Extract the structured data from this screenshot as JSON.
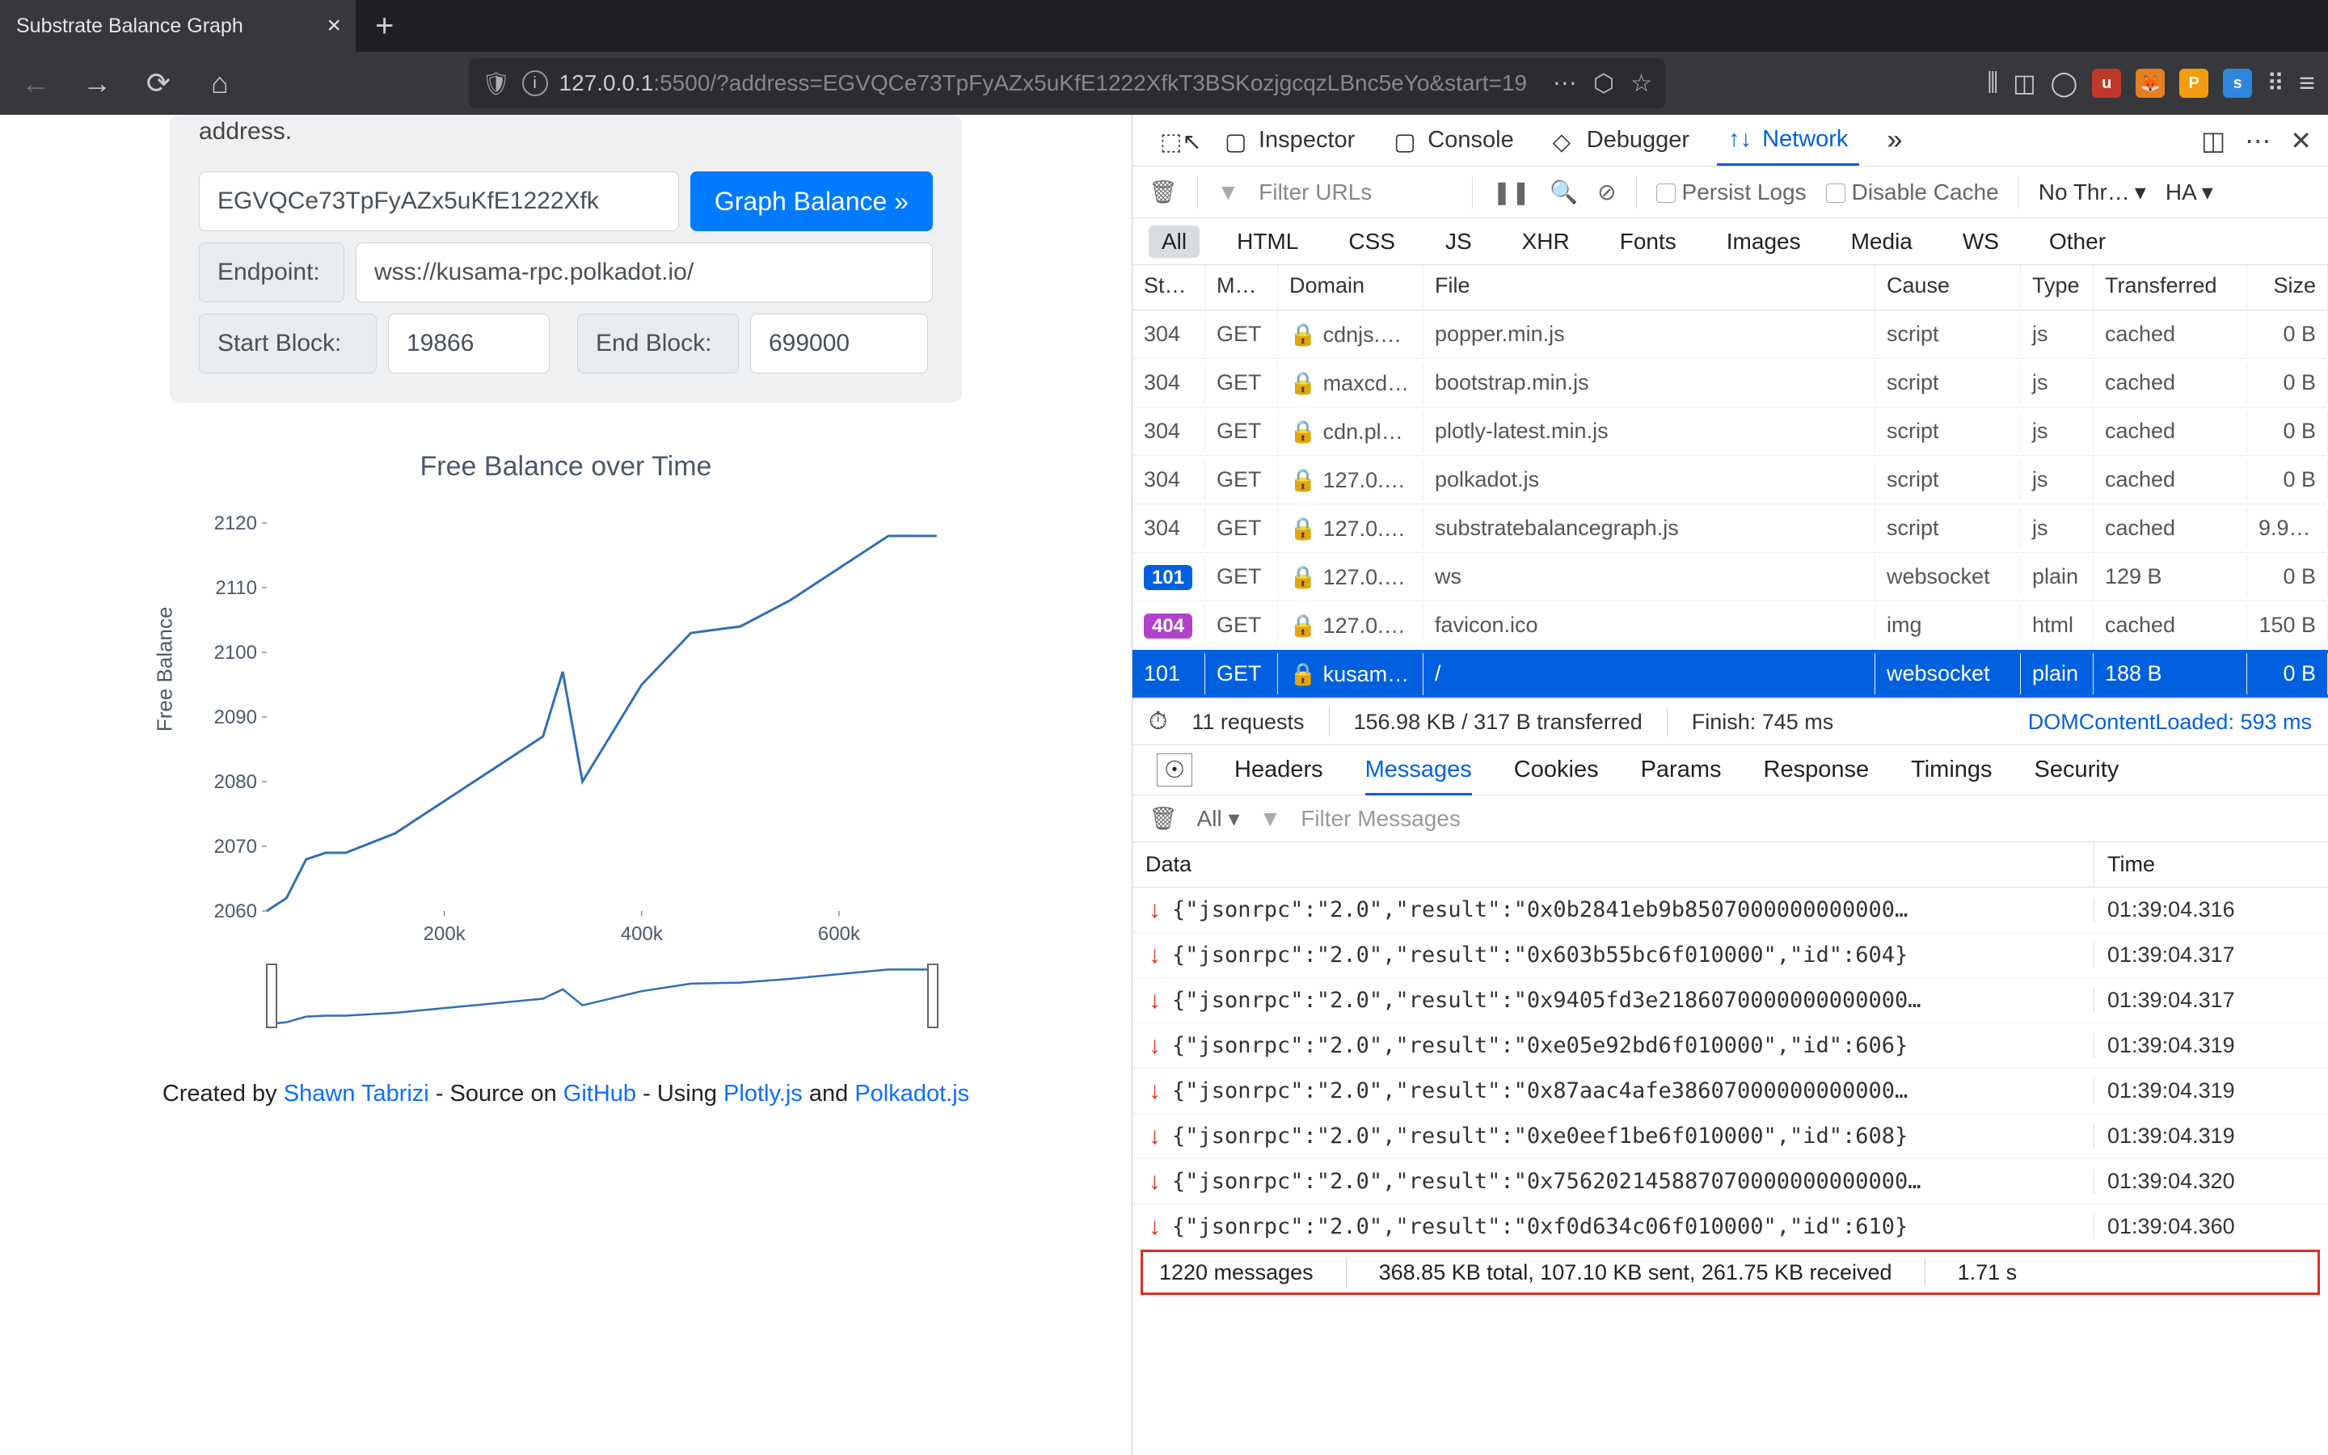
{
  "browser": {
    "tab_title": "Substrate Balance Graph",
    "url_host": "127.0.0.1",
    "url_port": ":5500",
    "url_rest": "/?address=EGVQCe73TpFyAZx5uKfE1222XfkT3BSKozjgcqzLBnc5eYo&start=19"
  },
  "form": {
    "desc_tail": "address.",
    "addr_value": "EGVQCe73TpFyAZx5uKfE1222Xfk",
    "graph_btn": "Graph Balance »",
    "endpoint_label": "Endpoint:",
    "endpoint_value": "wss://kusama-rpc.polkadot.io/",
    "start_label": "Start Block:",
    "start_value": "19866",
    "end_label": "End Block:",
    "end_value": "699000"
  },
  "chart_data": {
    "type": "line",
    "title": "Free Balance over Time",
    "xlabel": "",
    "ylabel": "Free Balance",
    "ylim": [
      2060,
      2120
    ],
    "xlim": [
      20000,
      700000
    ],
    "x_ticks": [
      "200k",
      "400k",
      "600k"
    ],
    "y_ticks": [
      2060,
      2070,
      2080,
      2090,
      2100,
      2110,
      2120
    ],
    "series": [
      {
        "name": "Free Balance",
        "x": [
          20000,
          40000,
          60000,
          80000,
          100000,
          150000,
          200000,
          250000,
          300000,
          320000,
          340000,
          360000,
          380000,
          400000,
          450000,
          500000,
          550000,
          600000,
          650000,
          699000
        ],
        "values": [
          2060,
          2062,
          2068,
          2069,
          2069,
          2072,
          2077,
          2082,
          2087,
          2097,
          2080,
          2085,
          2090,
          2095,
          2103,
          2104,
          2108,
          2113,
          2118,
          2118
        ]
      }
    ],
    "rangeslider": true
  },
  "footer": {
    "created_by": "Created by ",
    "author": "Shawn Tabrizi",
    "source_on": " - Source on ",
    "github": "GitHub",
    "using": " - Using ",
    "plotly": "Plotly.js",
    "and": " and ",
    "polkadot": "Polkadot.js"
  },
  "devtools": {
    "tabs": {
      "inspector": "Inspector",
      "console": "Console",
      "debugger": "Debugger",
      "network": "Network"
    },
    "toolbar": {
      "filter_placeholder": "Filter URLs",
      "persist": "Persist Logs",
      "disable_cache": "Disable Cache",
      "throttle": "No Thr…",
      "har": "HA"
    },
    "type_filters": [
      "All",
      "HTML",
      "CSS",
      "JS",
      "XHR",
      "Fonts",
      "Images",
      "Media",
      "WS",
      "Other"
    ],
    "cols": {
      "status": "Sta…",
      "method": "Me…",
      "domain": "Domain",
      "file": "File",
      "cause": "Cause",
      "type": "Type",
      "trans": "Transferred",
      "size": "Size"
    },
    "rows": [
      {
        "status": "304",
        "method": "GET",
        "domain": "cdnjs.cl…",
        "file": "popper.min.js",
        "cause": "script",
        "type": "js",
        "trans": "cached",
        "size": "0 B"
      },
      {
        "status": "304",
        "method": "GET",
        "domain": "maxcdn…",
        "file": "bootstrap.min.js",
        "cause": "script",
        "type": "js",
        "trans": "cached",
        "size": "0 B"
      },
      {
        "status": "304",
        "method": "GET",
        "domain": "cdn.plot…",
        "file": "plotly-latest.min.js",
        "cause": "script",
        "type": "js",
        "trans": "cached",
        "size": "0 B"
      },
      {
        "status": "304",
        "method": "GET",
        "domain": "127.0.0.…",
        "file": "polkadot.js",
        "cause": "script",
        "type": "js",
        "trans": "cached",
        "size": "0 B"
      },
      {
        "status": "304",
        "method": "GET",
        "domain": "127.0.0.…",
        "file": "substratebalancegraph.js",
        "cause": "script",
        "type": "js",
        "trans": "cached",
        "size": "9.93…"
      },
      {
        "status": "101",
        "badge": "b101",
        "method": "GET",
        "domain": "127.0.0.…",
        "file": "ws",
        "cause": "websocket",
        "type": "plain",
        "trans": "129 B",
        "size": "0 B"
      },
      {
        "status": "404",
        "badge": "b404",
        "method": "GET",
        "domain": "127.0.0.…",
        "file": "favicon.ico",
        "cause": "img",
        "type": "html",
        "trans": "cached",
        "size": "150 B"
      },
      {
        "status": "101",
        "sel": true,
        "method": "GET",
        "domain": "kusama…",
        "file": "/",
        "cause": "websocket",
        "type": "plain",
        "trans": "188 B",
        "size": "0 B"
      }
    ],
    "summary": {
      "requests": "11 requests",
      "transferred": "156.98 KB / 317 B transferred",
      "finish": "Finish: 745 ms",
      "dcl": "DOMContentLoaded: 593 ms"
    },
    "subtabs": [
      "Headers",
      "Messages",
      "Cookies",
      "Params",
      "Response",
      "Timings",
      "Security"
    ],
    "subtab_active": "Messages",
    "msg_toolbar": {
      "all": "All",
      "filter": "Filter Messages"
    },
    "msg_cols": {
      "data": "Data",
      "time": "Time"
    },
    "messages": [
      {
        "data": "{\"jsonrpc\":\"2.0\",\"result\":\"0x0b2841eb9b8507000000000000…",
        "time": "01:39:04.316"
      },
      {
        "data": "{\"jsonrpc\":\"2.0\",\"result\":\"0x603b55bc6f010000\",\"id\":604}",
        "time": "01:39:04.317"
      },
      {
        "data": "{\"jsonrpc\":\"2.0\",\"result\":\"0x9405fd3e2186070000000000000…",
        "time": "01:39:04.317"
      },
      {
        "data": "{\"jsonrpc\":\"2.0\",\"result\":\"0xe05e92bd6f010000\",\"id\":606}",
        "time": "01:39:04.319"
      },
      {
        "data": "{\"jsonrpc\":\"2.0\",\"result\":\"0x87aac4afe38607000000000000…",
        "time": "01:39:04.319"
      },
      {
        "data": "{\"jsonrpc\":\"2.0\",\"result\":\"0xe0eef1be6f010000\",\"id\":608}",
        "time": "01:39:04.319"
      },
      {
        "data": "{\"jsonrpc\":\"2.0\",\"result\":\"0x756202145887070000000000000…",
        "time": "01:39:04.320"
      },
      {
        "data": "{\"jsonrpc\":\"2.0\",\"result\":\"0xf0d634c06f010000\",\"id\":610}",
        "time": "01:39:04.360"
      }
    ],
    "msg_footer": {
      "count": "1220 messages",
      "totals": "368.85 KB total, 107.10 KB sent, 261.75 KB received",
      "duration": "1.71 s"
    }
  }
}
